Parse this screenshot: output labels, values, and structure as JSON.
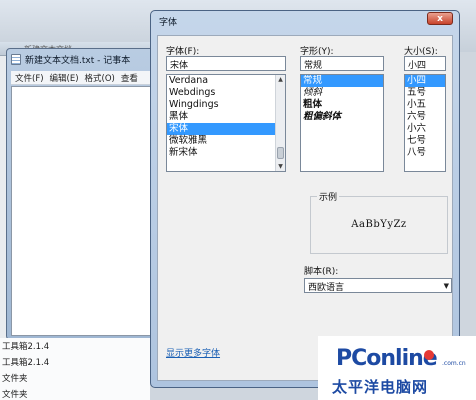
{
  "background": {
    "folder_title": "新建文本文档",
    "list_items": [
      "工具箱2.1.4",
      "工具箱2.1.4",
      "文件夹",
      "文件夹"
    ]
  },
  "notepad": {
    "title": "新建文本文档.txt - 记事本",
    "menu": [
      "文件(F)",
      "编辑(E)",
      "格式(O)",
      "查看"
    ]
  },
  "dialog": {
    "title": "字体",
    "close_glyph": "x",
    "font": {
      "label": "字体(F):",
      "value": "宋体",
      "items": [
        "Verdana",
        "Webdings",
        "Wingdings",
        "黑体",
        "宋体",
        "微软雅黑",
        "新宋体"
      ],
      "selected": "宋体"
    },
    "style": {
      "label": "字形(Y):",
      "value": "常规",
      "items": [
        "常规",
        "倾斜",
        "粗体",
        "粗偏斜体"
      ],
      "selected": "常规"
    },
    "size": {
      "label": "大小(S):",
      "value": "小四",
      "items": [
        "小四",
        "五号",
        "小五",
        "六号",
        "小六",
        "七号",
        "八号"
      ],
      "selected": "小四"
    },
    "sample": {
      "label": "示例",
      "text": "AaBbYyZz"
    },
    "script": {
      "label": "脚本(R):",
      "value": "西欧语言"
    },
    "more_fonts_link": "显示更多字体"
  },
  "watermark": {
    "main": "PConline",
    "sub": "太平洋电脑网",
    "small": ".com.cn"
  },
  "colors": {
    "selection": "#3399ff",
    "link": "#1a5fb4",
    "logo": "#1d4aa3",
    "logo_dot": "#e53935"
  }
}
